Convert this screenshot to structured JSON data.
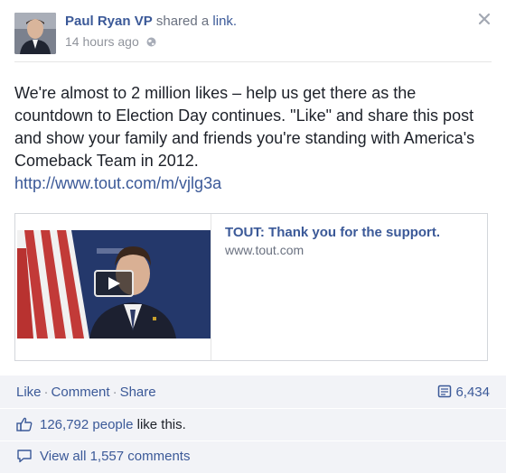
{
  "post": {
    "author": "Paul Ryan VP",
    "verb": "shared a",
    "object": "link.",
    "timestamp": "14 hours ago",
    "message": "We're almost to 2 million likes – help us get there as the countdown to Election Day continues. \"Like\" and share this post and show your family and friends you're standing with America's Comeback Team in 2012.",
    "link": "http://www.tout.com/m/vjlg3a"
  },
  "attachment": {
    "title": "TOUT: Thank you for the support.",
    "domain": "www.tout.com"
  },
  "actions": {
    "like": "Like",
    "comment": "Comment",
    "share": "Share",
    "separator": "·",
    "share_count": "6,434"
  },
  "likes": {
    "count_people": "126,792 people",
    "suffix": "like this."
  },
  "comments": {
    "view_all": "View all 1,557 comments"
  },
  "icons": {
    "close": "close-icon",
    "globe": "globe-icon",
    "play": "play-icon",
    "shares": "shares-icon",
    "thumbs_up": "thumbs-up-icon",
    "comment": "comment-bubble-icon"
  },
  "colors": {
    "link_blue": "#3b5998",
    "ufi_background": "#f2f3f7"
  }
}
